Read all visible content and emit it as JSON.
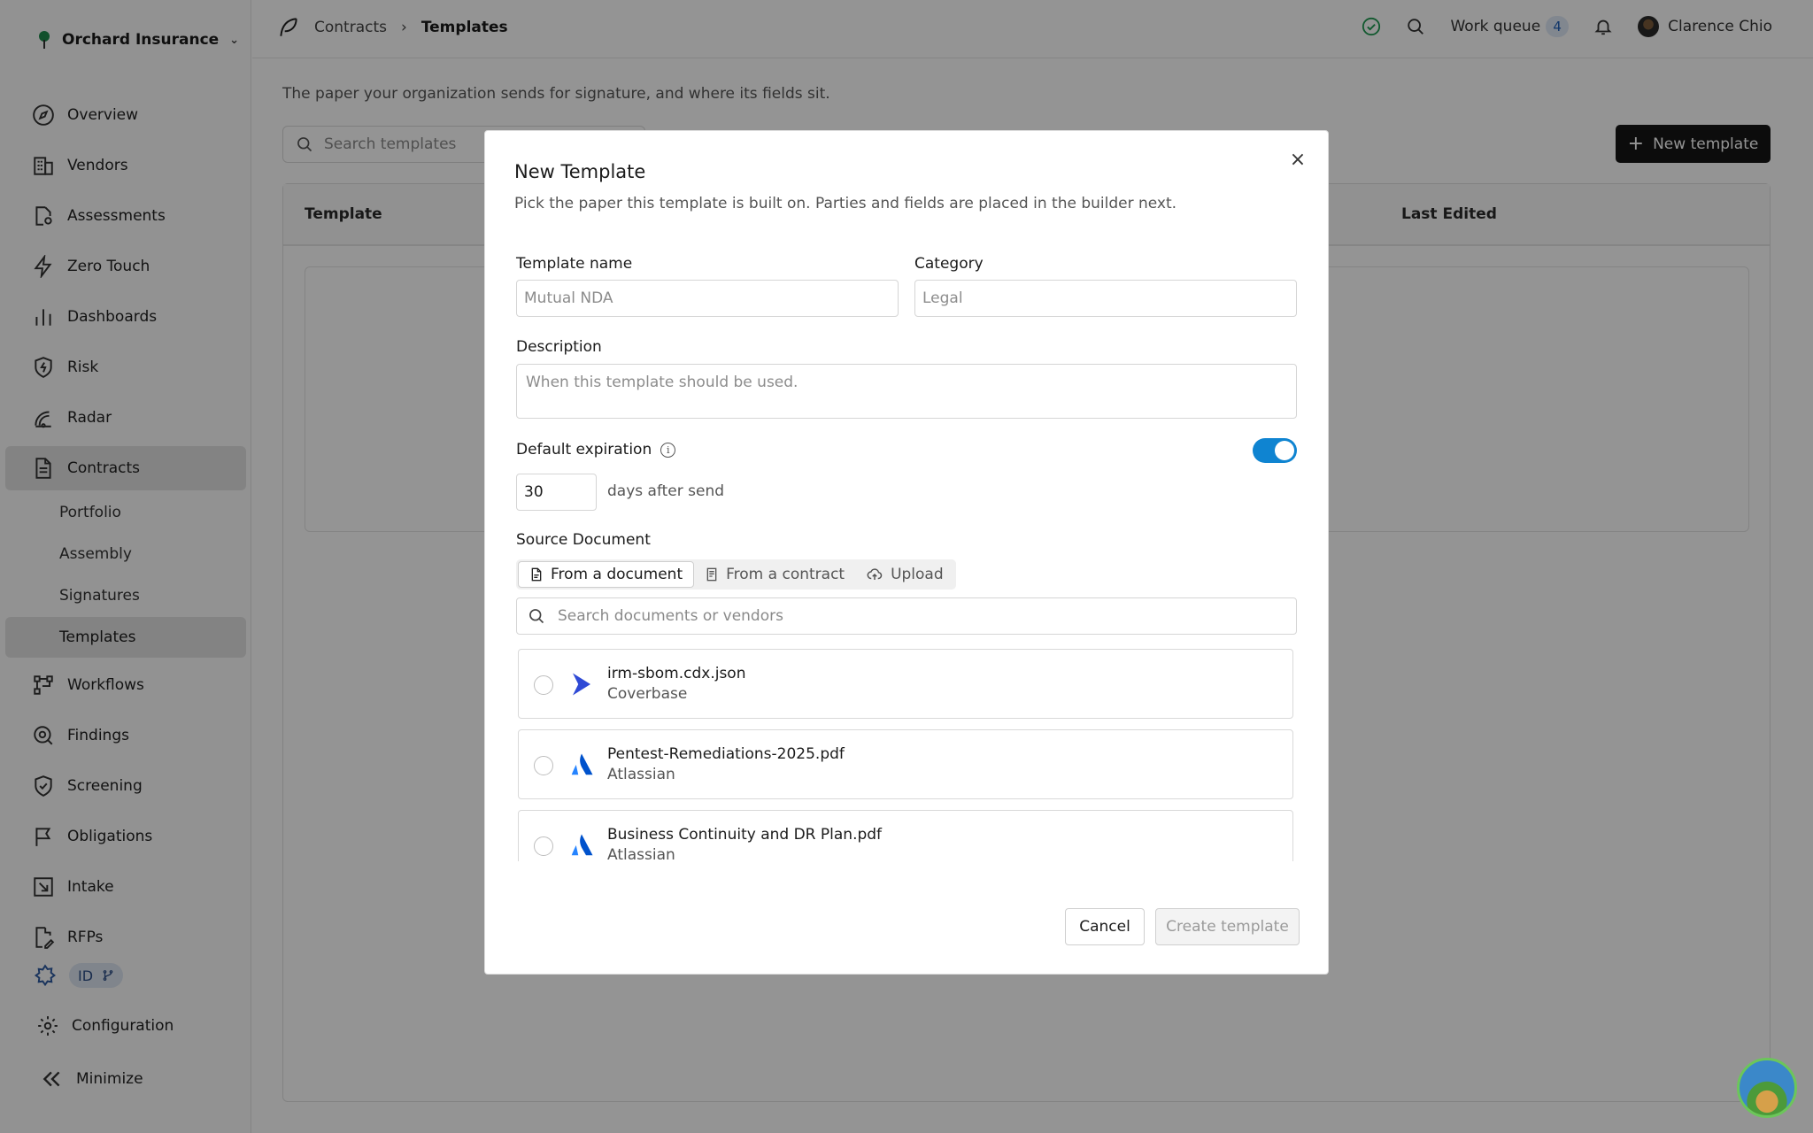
{
  "org": {
    "name": "Orchard Insurance"
  },
  "sidebar": {
    "items": [
      {
        "label": "Overview",
        "icon": "compass-icon"
      },
      {
        "label": "Vendors",
        "icon": "building-icon"
      },
      {
        "label": "Assessments",
        "icon": "document-gear-icon"
      },
      {
        "label": "Zero Touch",
        "icon": "lightning-icon"
      },
      {
        "label": "Dashboards",
        "icon": "bar-chart-icon"
      },
      {
        "label": "Risk",
        "icon": "shield-bolt-icon"
      },
      {
        "label": "Radar",
        "icon": "radar-icon"
      },
      {
        "label": "Contracts",
        "icon": "file-text-icon"
      },
      {
        "label": "Workflows",
        "icon": "workflow-icon"
      },
      {
        "label": "Findings",
        "icon": "magnify-icon"
      },
      {
        "label": "Screening",
        "icon": "shield-check-icon"
      },
      {
        "label": "Obligations",
        "icon": "flag-icon"
      },
      {
        "label": "Intake",
        "icon": "inbox-arrow-icon"
      },
      {
        "label": "RFPs",
        "icon": "file-pen-icon"
      }
    ],
    "contracts_sub": [
      "Portfolio",
      "Assembly",
      "Signatures",
      "Templates"
    ],
    "id_pill": "ID",
    "configuration": "Configuration",
    "minimize": "Minimize"
  },
  "topbar": {
    "breadcrumb": [
      "Contracts",
      "Templates"
    ],
    "work_queue_label": "Work queue",
    "work_queue_count": "4",
    "user_name": "Clarence Chio"
  },
  "page": {
    "subtitle": "The paper your organization sends for signature, and where its fields sit.",
    "search_placeholder": "Search templates",
    "new_template_label": "New template",
    "table_headers": [
      "Template",
      "Last Edited"
    ]
  },
  "modal": {
    "title": "New Template",
    "description": "Pick the paper this template is built on. Parties and fields are placed in the builder next.",
    "template_name_label": "Template name",
    "template_name_placeholder": "Mutual NDA",
    "category_label": "Category",
    "category_placeholder": "Legal",
    "description_label": "Description",
    "description_placeholder": "When this template should be used.",
    "default_expiration_label": "Default expiration",
    "expiration_enabled": true,
    "expiration_days": "30",
    "expiration_suffix": "days after send",
    "source_document_label": "Source Document",
    "source_tabs": [
      "From a document",
      "From a contract",
      "Upload"
    ],
    "doc_search_placeholder": "Search documents or vendors",
    "documents": [
      {
        "name": "irm-sbom.cdx.json",
        "vendor": "Coverbase",
        "logo": "coverbase-logo-icon"
      },
      {
        "name": "Pentest-Remediations-2025.pdf",
        "vendor": "Atlassian",
        "logo": "atlassian-logo-icon"
      },
      {
        "name": "Business Continuity and DR Plan.pdf",
        "vendor": "Atlassian",
        "logo": "atlassian-logo-icon"
      }
    ],
    "cancel_label": "Cancel",
    "create_label": "Create template"
  },
  "colors": {
    "toggle_on": "#0f84d1",
    "primary_button": "#151515",
    "atlassian_blue": "#2684ff",
    "coverbase_blue": "#2f4ad6"
  }
}
